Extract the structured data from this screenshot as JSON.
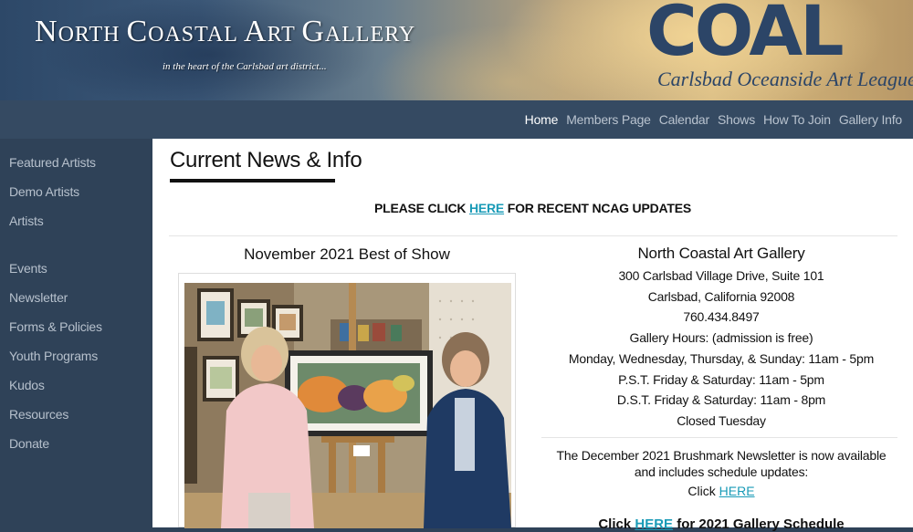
{
  "header": {
    "site_title_parts": [
      {
        "cap": "N",
        "rest": "ORTH "
      },
      {
        "cap": "C",
        "rest": "OASTAL "
      },
      {
        "cap": "A",
        "rest": "RT "
      },
      {
        "cap": "G",
        "rest": "ALLERY"
      }
    ],
    "tagline": "in the heart of the Carlsbad art district...",
    "logo_text": "COAL",
    "logo_sub": "Carlsbad Oceanside Art League"
  },
  "nav": {
    "items": [
      "Home",
      "Members Page",
      "Calendar",
      "Shows",
      "How To Join",
      "Gallery Info"
    ],
    "active": "Home"
  },
  "sidebar": {
    "items": [
      "Featured Artists",
      "Demo Artists",
      "Artists",
      "Events",
      "Newsletter",
      "Forms & Policies",
      "Youth Programs",
      "Kudos",
      "Resources",
      "Donate"
    ]
  },
  "main": {
    "page_title": "Current News & Info",
    "notice_before": "PLEASE CLICK ",
    "notice_link": "HERE",
    "notice_after": " FOR RECENT NCAG UPDATES",
    "best_title": "November 2021 Best of Show",
    "gallery": {
      "name": "North Coastal Art Gallery",
      "address": "300 Carlsbad Village Drive, Suite 101",
      "city": "Carlsbad, California 92008",
      "phone": "760.434.8497",
      "hours_label": "Gallery Hours: (admission is free)",
      "hours_1": "Monday, Wednesday, Thursday, & Sunday: 11am - 5pm",
      "hours_2": "P.S.T. Friday & Saturday: 11am - 5pm",
      "hours_3": "D.S.T. Friday & Saturday: 11am - 8pm",
      "hours_4": "Closed Tuesday"
    },
    "newsletter_line1": "The December 2021 Brushmark Newsletter is now available",
    "newsletter_line2": "and includes schedule updates:",
    "click_word": "Click ",
    "newsletter_link": "HERE",
    "schedule_before": "Click ",
    "schedule_link": "HERE",
    "schedule_after": " for 2021 Gallery Schedule"
  },
  "colors": {
    "sidebar_bg": "#2f4258",
    "nav_bg": "#354a62",
    "link": "#1a9bb7"
  }
}
